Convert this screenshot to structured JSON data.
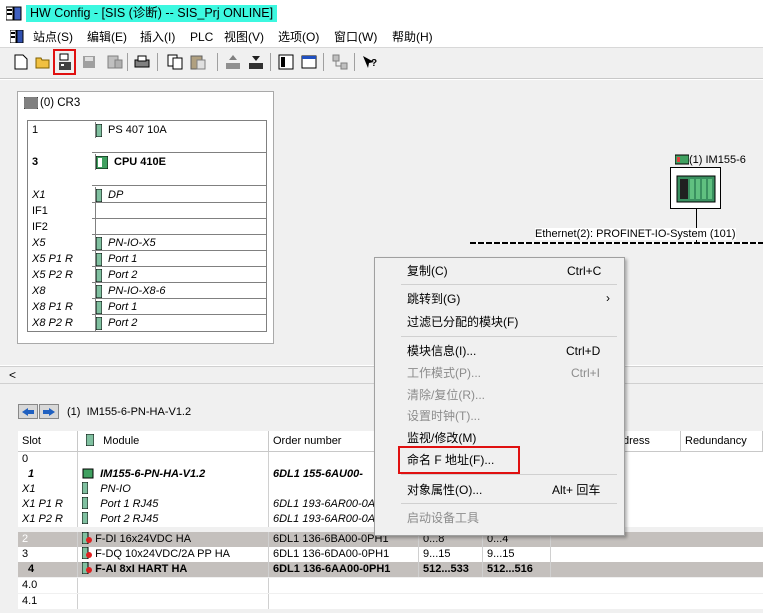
{
  "window": {
    "title": "HW Config - [SIS (诊断) -- SIS_Prj  ONLINE]"
  },
  "menu": {
    "items": [
      "站点(S)",
      "编辑(E)",
      "插入(I)",
      "PLC",
      "视图(V)",
      "选项(O)",
      "窗口(W)",
      "帮助(H)"
    ]
  },
  "toolbar": {
    "icons": [
      "new-icon",
      "open-icon",
      "download-station-icon",
      "save-icon",
      "compile-icon",
      "print-icon",
      "copy-icon",
      "paste-icon",
      "upload-icon",
      "download-icon",
      "catalog-icon",
      "network-view-icon",
      "config-icon",
      "help-icon"
    ]
  },
  "rack": {
    "title": "(0) CR3",
    "rows": [
      {
        "slot": "1",
        "module": "PS 407 10A"
      },
      {
        "slot": "3",
        "module": "CPU 410E"
      },
      {
        "slot": "X1",
        "module": "DP"
      },
      {
        "slot": "IF1",
        "module": ""
      },
      {
        "slot": "IF2",
        "module": ""
      },
      {
        "slot": "X5",
        "module": "PN-IO-X5"
      },
      {
        "slot": "X5 P1 R",
        "module": "Port 1"
      },
      {
        "slot": "X5 P2 R",
        "module": "Port 2"
      },
      {
        "slot": "X8",
        "module": "PN-IO-X8-6"
      },
      {
        "slot": "X8 P1 R",
        "module": "Port 1"
      },
      {
        "slot": "X8 P2 R",
        "module": "Port 2"
      }
    ]
  },
  "network": {
    "label": "Ethernet(2): PROFINET-IO-System (101)",
    "device": "(1) IM155-6"
  },
  "detail": {
    "title_num": "(1)",
    "title": "IM155-6-PN-HA-V1.2",
    "columns": [
      "Slot",
      "Module",
      "Order number",
      "dress",
      "Redundancy"
    ],
    "rows": [
      {
        "slot": "0",
        "module": "",
        "order": "",
        "i": "",
        "q": ""
      },
      {
        "slot": "1",
        "module": "IM155-6-PN-HA-V1.2",
        "order": "6DL1 155-6AU00-",
        "i": "",
        "q": ""
      },
      {
        "slot": "X1",
        "module": "PN-IO",
        "order": "",
        "i": "",
        "q": ""
      },
      {
        "slot": "X1 P1 R",
        "module": "Port 1 RJ45",
        "order": "6DL1 193-6AR00-0AA",
        "i": "",
        "q": ""
      },
      {
        "slot": "X1 P2 R",
        "module": "Port 2 RJ45",
        "order": "6DL1 193-6AR00-0AA",
        "i": "",
        "q": ""
      },
      {
        "slot": "2",
        "module": "F-DI 16x24VDC HA",
        "order": "6DL1 136-6BA00-0PH1",
        "i": "0...8",
        "q": "0...4"
      },
      {
        "slot": "3",
        "module": "F-DQ 10x24VDC/2A PP HA",
        "order": "6DL1 136-6DA00-0PH1",
        "i": "9...15",
        "q": "9...15"
      },
      {
        "slot": "4",
        "module": "F-AI 8xI HART HA",
        "order": "6DL1 136-6AA00-0PH1",
        "i": "512...533",
        "q": "512...516"
      },
      {
        "slot": "4.0",
        "module": "",
        "order": "",
        "i": "",
        "q": ""
      },
      {
        "slot": "4.1",
        "module": "",
        "order": "",
        "i": "",
        "q": ""
      }
    ]
  },
  "context_menu": {
    "copy": "复制(C)",
    "copy_key": "Ctrl+C",
    "goto": "跳转到(G)",
    "filter": "过滤已分配的模块(F)",
    "module_info": "模块信息(I)...",
    "module_info_key": "Ctrl+D",
    "op_mode": "工作模式(P)...",
    "op_mode_key": "Ctrl+I",
    "clear_reset": "清除/复位(R)...",
    "set_time": "设置时钟(T)...",
    "monitor": "监视/修改(M)",
    "name_f_address": "命名 F 地址(F)...",
    "properties": "对象属性(O)...",
    "properties_key": "Alt+ 回车",
    "start_tool": "启动设备工具"
  }
}
